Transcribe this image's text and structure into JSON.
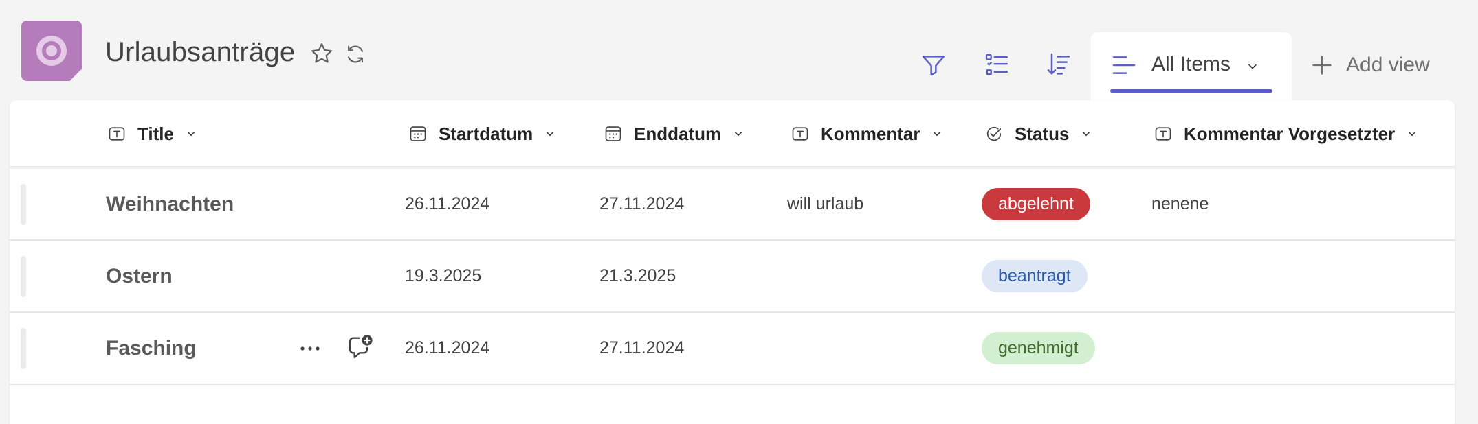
{
  "header": {
    "title": "Urlaubsanträge",
    "app_icon": "list-app-icon",
    "favorite_icon": "star-icon",
    "refresh_icon": "sync-icon"
  },
  "toolbar": {
    "filter_icon": "filter-icon",
    "edit_list_icon": "checklist-icon",
    "sort_icon": "sort-icon",
    "view": {
      "label": "All Items",
      "icon": "lines-icon"
    },
    "add_view_label": "Add view"
  },
  "columns": [
    {
      "label": "Title",
      "icon": "text-type-icon"
    },
    {
      "label": "Startdatum",
      "icon": "calendar-icon"
    },
    {
      "label": "Enddatum",
      "icon": "calendar-icon"
    },
    {
      "label": "Kommentar",
      "icon": "text-type-icon"
    },
    {
      "label": "Status",
      "icon": "check-circle-icon"
    },
    {
      "label": "Kommentar Vorgesetzter",
      "icon": "text-type-icon"
    }
  ],
  "rows": [
    {
      "title": "Weihnachten",
      "start": "26.11.2024",
      "end": "27.11.2024",
      "kommentar": "will urlaub",
      "status": "abgelehnt",
      "kommentar_vorgesetzter": "nenene"
    },
    {
      "title": "Ostern",
      "start": "19.3.2025",
      "end": "21.3.2025",
      "kommentar": "",
      "status": "beantragt",
      "kommentar_vorgesetzter": ""
    },
    {
      "title": "Fasching",
      "start": "26.11.2024",
      "end": "27.11.2024",
      "kommentar": "",
      "status": "genehmigt",
      "kommentar_vorgesetzter": ""
    }
  ],
  "status_colors": {
    "abgelehnt": "#c9393d",
    "beantragt": "#dde7f5",
    "genehmigt": "#d3efd1"
  },
  "accent_color": "#5b5fc7"
}
